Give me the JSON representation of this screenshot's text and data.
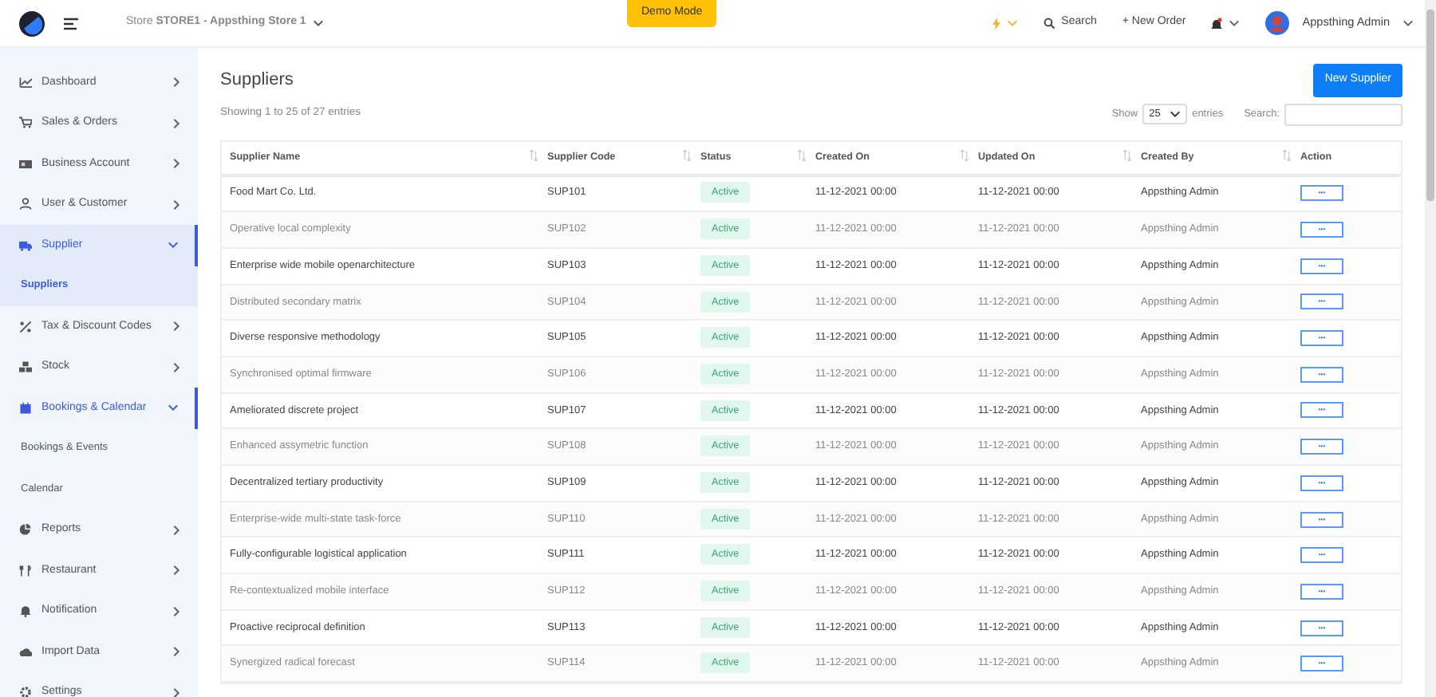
{
  "topbar": {
    "store": "Store **STORE1 - Appsthing Store 1**",
    "demo_button": "Demo Mode",
    "search": "Search",
    "new_order": "+ New Order",
    "user": "Appsthing Admin"
  },
  "sidebar": {
    "items": [
      {
        "label": "Dashboard",
        "kind": "main",
        "expanded": false,
        "selected": false
      },
      {
        "label": "Sales & Orders",
        "kind": "main",
        "expanded": false,
        "selected": false
      },
      {
        "label": "Business Account",
        "kind": "main",
        "expanded": false,
        "selected": false
      },
      {
        "label": "User & Customer",
        "kind": "main",
        "expanded": false,
        "selected": false
      },
      {
        "label": "Supplier",
        "kind": "main",
        "expanded": true,
        "selected": true
      },
      {
        "label": "Suppliers",
        "kind": "sub",
        "selected": true
      },
      {
        "label": "Tax & Discount Codes",
        "kind": "main",
        "expanded": false,
        "selected": false
      },
      {
        "label": "Stock",
        "kind": "main",
        "expanded": false,
        "selected": false
      },
      {
        "label": "Bookings & Calendar",
        "kind": "main",
        "expanded": true,
        "selected": false
      },
      {
        "label": "Bookings & Events",
        "kind": "sub",
        "selected": false
      },
      {
        "label": "Calendar",
        "kind": "sub",
        "selected": false
      },
      {
        "label": "Reports",
        "kind": "main",
        "expanded": false,
        "selected": false
      },
      {
        "label": "Restaurant",
        "kind": "main",
        "expanded": false,
        "selected": false
      },
      {
        "label": "Notification",
        "kind": "main",
        "expanded": false,
        "selected": false
      },
      {
        "label": "Import Data",
        "kind": "main",
        "expanded": false,
        "selected": false
      },
      {
        "label": "Settings",
        "kind": "main",
        "expanded": false,
        "selected": false
      }
    ]
  },
  "page": {
    "title": "Suppliers",
    "new_button": "New Supplier",
    "info": "Showing 1 to 25 of 27 entries",
    "show_label": "Show",
    "page_size": "25",
    "entries_label": "entries",
    "search_label": "Search:"
  },
  "table": {
    "columns": [
      "Supplier Name",
      "Supplier Code",
      "Status",
      "Created On",
      "Updated On",
      "Created By",
      "Action"
    ],
    "rows": [
      {
        "name": "Food Mart Co. Ltd.",
        "code": "SUP101",
        "status": "Active",
        "created": "11-12-2021 00:00",
        "updated": "11-12-2021 00:00",
        "by": "Appsthing Admin",
        "action": "•••"
      },
      {
        "name": "Operative local complexity",
        "code": "SUP102",
        "status": "Active",
        "created": "11-12-2021 00:00",
        "updated": "11-12-2021 00:00",
        "by": "Appsthing Admin",
        "action": "•••"
      },
      {
        "name": "Enterprise wide mobile openarchitecture",
        "code": "SUP103",
        "status": "Active",
        "created": "11-12-2021 00:00",
        "updated": "11-12-2021 00:00",
        "by": "Appsthing Admin",
        "action": "•••"
      },
      {
        "name": "Distributed secondary matrix",
        "code": "SUP104",
        "status": "Active",
        "created": "11-12-2021 00:00",
        "updated": "11-12-2021 00:00",
        "by": "Appsthing Admin",
        "action": "•••"
      },
      {
        "name": "Diverse responsive methodology",
        "code": "SUP105",
        "status": "Active",
        "created": "11-12-2021 00:00",
        "updated": "11-12-2021 00:00",
        "by": "Appsthing Admin",
        "action": "•••"
      },
      {
        "name": "Synchronised optimal firmware",
        "code": "SUP106",
        "status": "Active",
        "created": "11-12-2021 00:00",
        "updated": "11-12-2021 00:00",
        "by": "Appsthing Admin",
        "action": "•••"
      },
      {
        "name": "Ameliorated discrete project",
        "code": "SUP107",
        "status": "Active",
        "created": "11-12-2021 00:00",
        "updated": "11-12-2021 00:00",
        "by": "Appsthing Admin",
        "action": "•••"
      },
      {
        "name": "Enhanced assymetric function",
        "code": "SUP108",
        "status": "Active",
        "created": "11-12-2021 00:00",
        "updated": "11-12-2021 00:00",
        "by": "Appsthing Admin",
        "action": "•••"
      },
      {
        "name": "Decentralized tertiary productivity",
        "code": "SUP109",
        "status": "Active",
        "created": "11-12-2021 00:00",
        "updated": "11-12-2021 00:00",
        "by": "Appsthing Admin",
        "action": "•••"
      },
      {
        "name": "Enterprise-wide multi-state task-force",
        "code": "SUP110",
        "status": "Active",
        "created": "11-12-2021 00:00",
        "updated": "11-12-2021 00:00",
        "by": "Appsthing Admin",
        "action": "•••"
      },
      {
        "name": "Fully-configurable logistical application",
        "code": "SUP111",
        "status": "Active",
        "created": "11-12-2021 00:00",
        "updated": "11-12-2021 00:00",
        "by": "Appsthing Admin",
        "action": "•••"
      },
      {
        "name": "Re-contextualized mobile interface",
        "code": "SUP112",
        "status": "Active",
        "created": "11-12-2021 00:00",
        "updated": "11-12-2021 00:00",
        "by": "Appsthing Admin",
        "action": "•••"
      },
      {
        "name": "Proactive reciprocal definition",
        "code": "SUP113",
        "status": "Active",
        "created": "11-12-2021 00:00",
        "updated": "11-12-2021 00:00",
        "by": "Appsthing Admin",
        "action": "•••"
      },
      {
        "name": "Synergized radical forecast",
        "code": "SUP114",
        "status": "Active",
        "created": "11-12-2021 00:00",
        "updated": "11-12-2021 00:00",
        "by": "Appsthing Admin",
        "action": "•••"
      }
    ]
  }
}
